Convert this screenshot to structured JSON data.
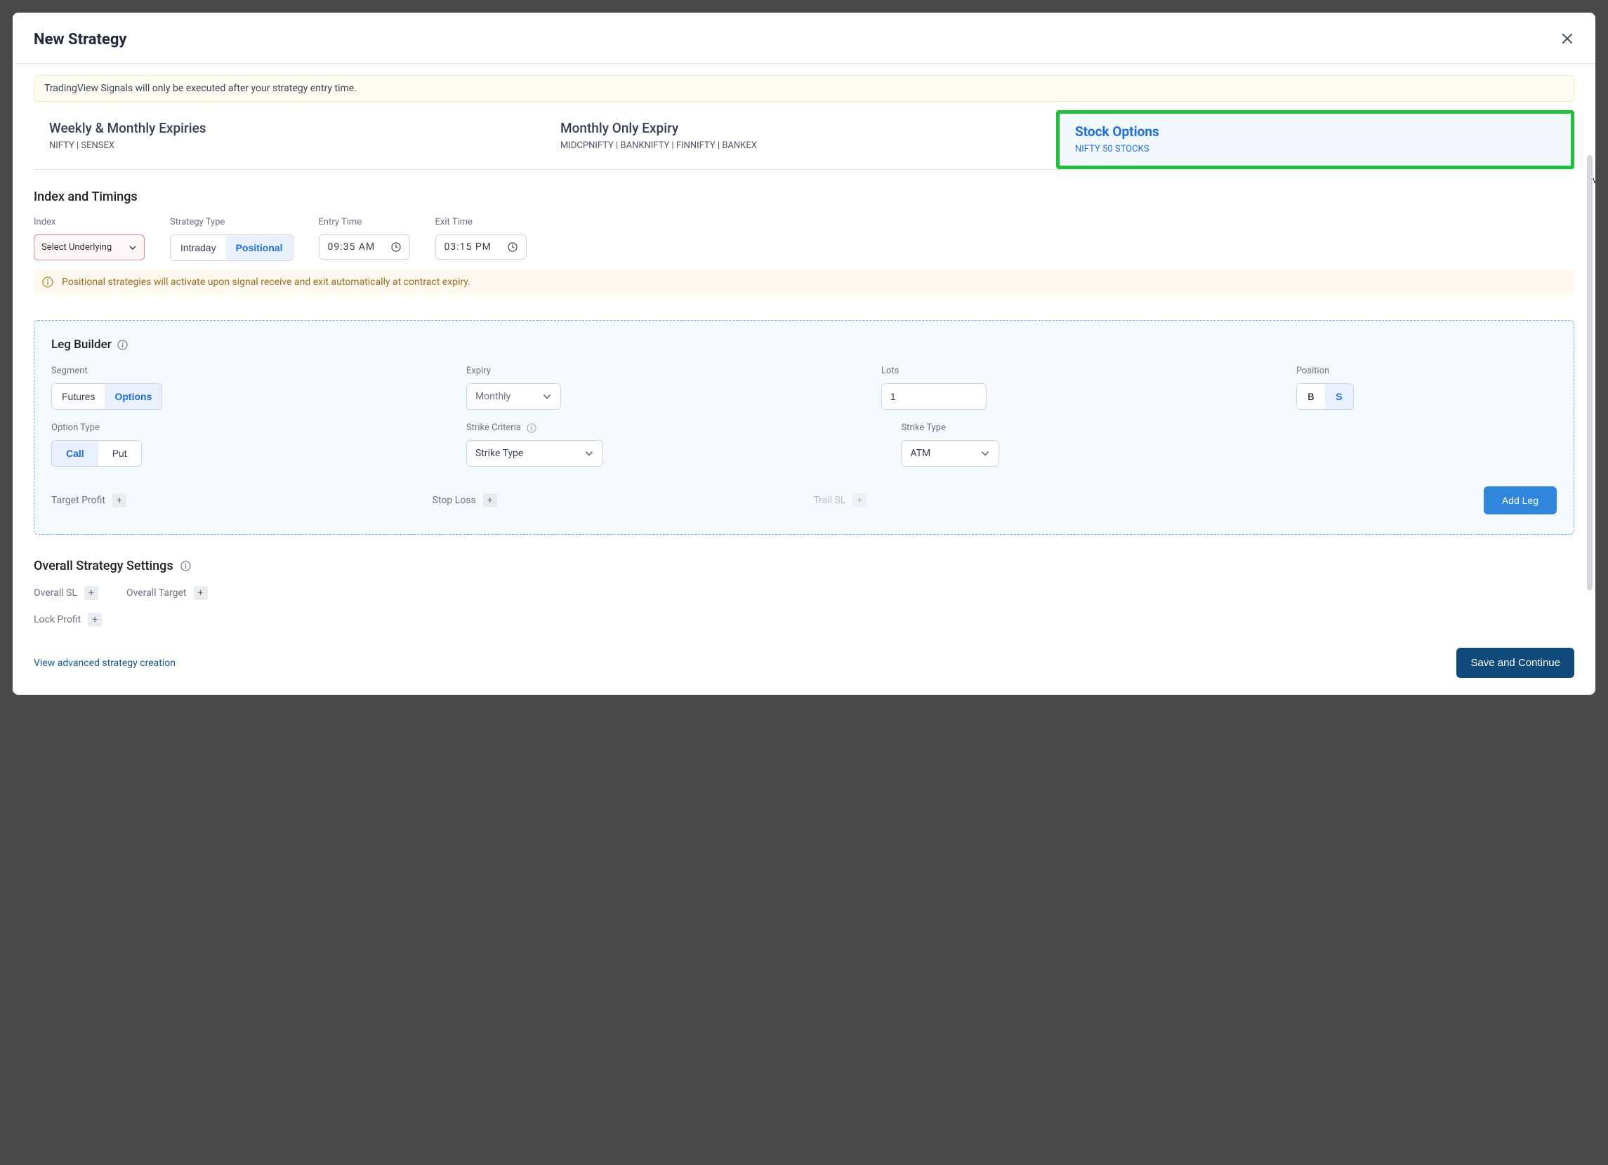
{
  "modal": {
    "title": "New Strategy"
  },
  "banner": "TradingView Signals will only be executed after your strategy entry time.",
  "tabs": [
    {
      "title": "Weekly & Monthly Expiries",
      "sub": "NIFTY | SENSEX"
    },
    {
      "title": "Monthly Only Expiry",
      "sub": "MIDCPNIFTY | BANKNIFTY | FINNIFTY | BANKEX"
    },
    {
      "title": "Stock Options",
      "sub": "NIFTY 50 STOCKS"
    }
  ],
  "indexTimings": {
    "heading": "Index and Timings",
    "indexLabel": "Index",
    "indexPlaceholder": "Select Underlying",
    "strategyTypeLabel": "Strategy Type",
    "strategyType": {
      "intraday": "Intraday",
      "positional": "Positional"
    },
    "entryLabel": "Entry Time",
    "entryTime": "09:35 AM",
    "exitLabel": "Exit Time",
    "exitTime": "03:15 PM"
  },
  "positionalNote": "Positional strategies will activate upon signal receive and exit automatically at contract expiry.",
  "bgText": "ive",
  "legBuilder": {
    "title": "Leg Builder",
    "labels": {
      "segment": "Segment",
      "expiry": "Expiry",
      "lots": "Lots",
      "position": "Position",
      "optionType": "Option Type",
      "strikeCriteria": "Strike Criteria",
      "strikeType": "Strike Type"
    },
    "segment": {
      "futures": "Futures",
      "options": "Options"
    },
    "expiryValue": "Monthly",
    "lotsValue": "1",
    "position": {
      "b": "B",
      "s": "S"
    },
    "optionType": {
      "call": "Call",
      "put": "Put"
    },
    "strikeCriteriaValue": "Strike Type",
    "strikeTypeValue": "ATM",
    "chips": {
      "targetProfit": "Target Profit",
      "stopLoss": "Stop Loss",
      "trailSL": "Trail SL"
    },
    "addLeg": "Add Leg"
  },
  "overall": {
    "title": "Overall Strategy Settings",
    "chips": {
      "overallSL": "Overall SL",
      "overallTarget": "Overall Target",
      "lockProfit": "Lock Profit"
    }
  },
  "footer": {
    "advanced": "View advanced strategy creation",
    "save": "Save and Continue"
  }
}
